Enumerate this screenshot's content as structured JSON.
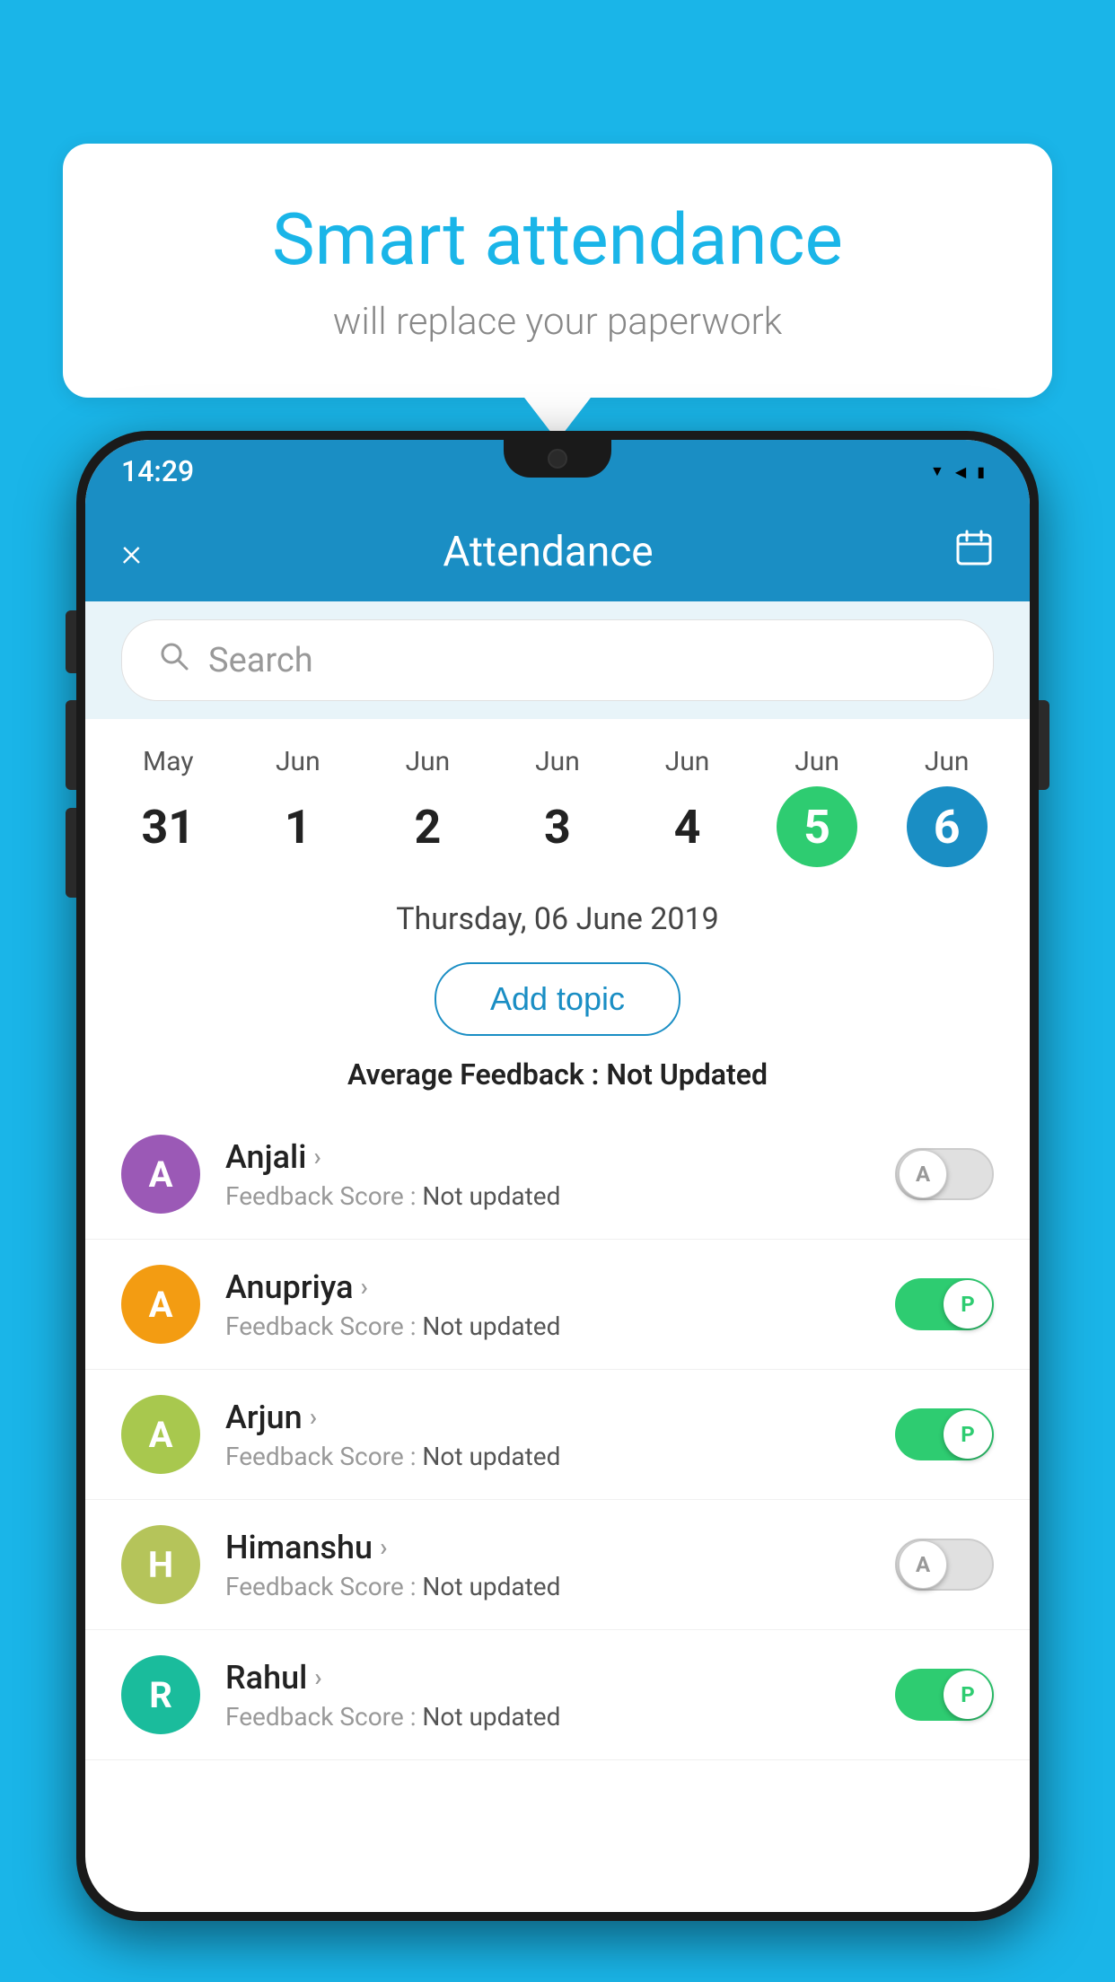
{
  "background_color": "#1ab5e8",
  "speech_bubble": {
    "title": "Smart attendance",
    "subtitle": "will replace your paperwork"
  },
  "status_bar": {
    "time": "14:29",
    "wifi": "▼",
    "signal": "▲",
    "battery": "🔋"
  },
  "app_bar": {
    "title": "Attendance",
    "close_label": "×",
    "calendar_icon": "📅"
  },
  "search": {
    "placeholder": "Search"
  },
  "calendar": {
    "days": [
      {
        "month": "May",
        "date": "31",
        "style": "normal"
      },
      {
        "month": "Jun",
        "date": "1",
        "style": "normal"
      },
      {
        "month": "Jun",
        "date": "2",
        "style": "normal"
      },
      {
        "month": "Jun",
        "date": "3",
        "style": "normal"
      },
      {
        "month": "Jun",
        "date": "4",
        "style": "normal"
      },
      {
        "month": "Jun",
        "date": "5",
        "style": "active-green"
      },
      {
        "month": "Jun",
        "date": "6",
        "style": "active-blue"
      }
    ],
    "selected_date": "Thursday, 06 June 2019"
  },
  "add_topic_button": "Add topic",
  "average_feedback_label": "Average Feedback : ",
  "average_feedback_value": "Not Updated",
  "students": [
    {
      "name": "Anjali",
      "initial": "A",
      "avatar_color": "purple",
      "feedback_label": "Feedback Score : ",
      "feedback_value": "Not updated",
      "toggle_state": "off",
      "toggle_label": "A"
    },
    {
      "name": "Anupriya",
      "initial": "A",
      "avatar_color": "yellow",
      "feedback_label": "Feedback Score : ",
      "feedback_value": "Not updated",
      "toggle_state": "on",
      "toggle_label": "P"
    },
    {
      "name": "Arjun",
      "initial": "A",
      "avatar_color": "green",
      "feedback_label": "Feedback Score : ",
      "feedback_value": "Not updated",
      "toggle_state": "on",
      "toggle_label": "P"
    },
    {
      "name": "Himanshu",
      "initial": "H",
      "avatar_color": "olive",
      "feedback_label": "Feedback Score : ",
      "feedback_value": "Not updated",
      "toggle_state": "off",
      "toggle_label": "A"
    },
    {
      "name": "Rahul",
      "initial": "R",
      "avatar_color": "teal",
      "feedback_label": "Feedback Score : ",
      "feedback_value": "Not updated",
      "toggle_state": "on",
      "toggle_label": "P"
    }
  ]
}
